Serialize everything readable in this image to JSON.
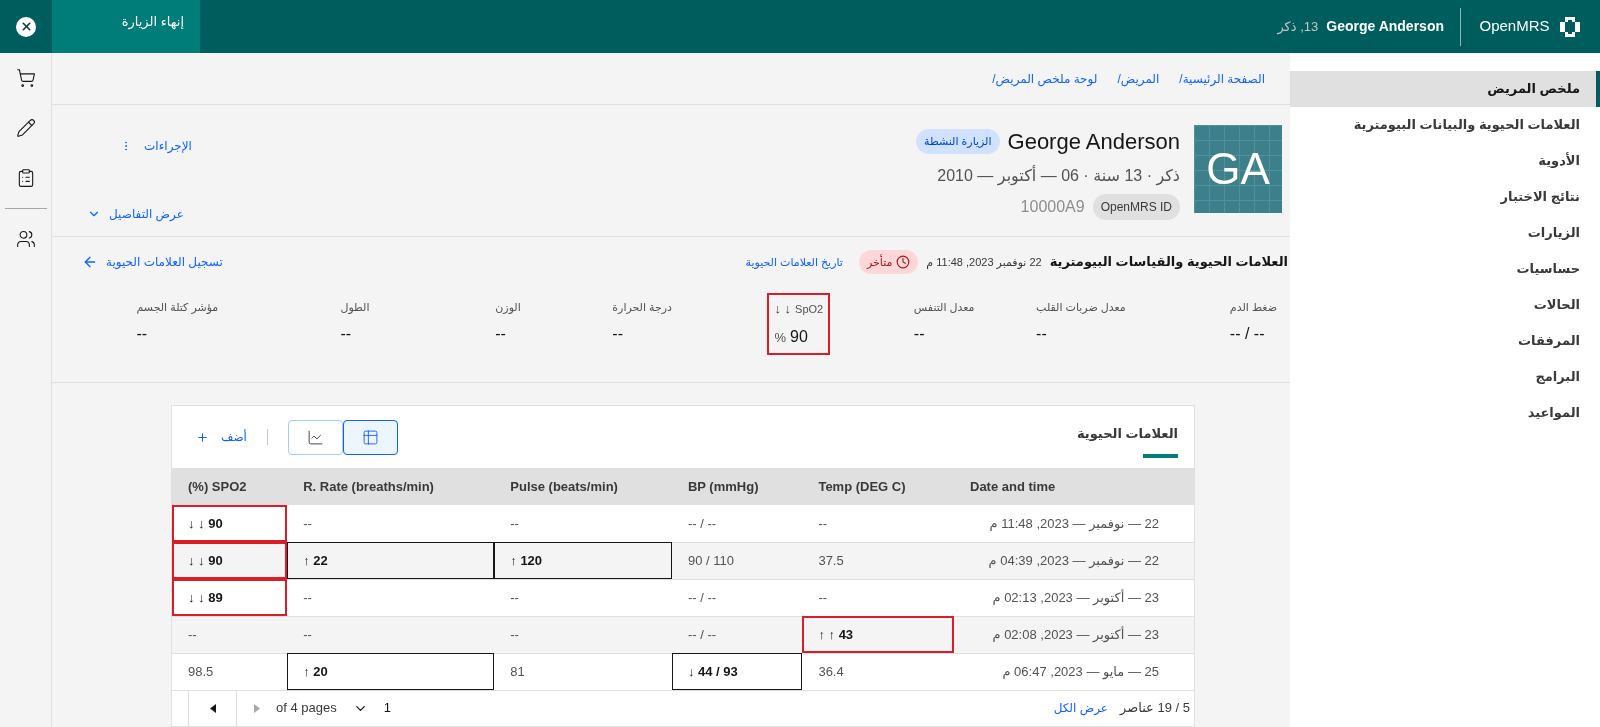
{
  "top_bar": {
    "end_visit_button": "إنهاء الزيارة",
    "patient_name": "George Anderson",
    "patient_info": "13, ذكر",
    "brand": "OpenMRS"
  },
  "breadcrumbs": [
    "الصفحة الرئيسية/",
    "المريض/",
    "لوحة ملخص المريض/"
  ],
  "patient": {
    "initials": "GA",
    "name": "George Anderson",
    "visit_tag": "الزيارة النشطة",
    "details": "ذكر · 13 سنة · 06 — أكتوبر — 2010",
    "id_label": "OpenMRS ID",
    "id_value": "10000A9",
    "actions": "الإجراءات",
    "show_details": "عرض التفاصيل"
  },
  "vitals_header": {
    "title": "العلامات الحيوية والقياسات البيومترية",
    "date": "22 نوفمبر 2023, 11:48 م",
    "status_tag": "متأخر",
    "history_link": "تاريخ العلامات الحيوية",
    "record_link": "تسجيل العلامات الحيوية"
  },
  "vitals_tiles": [
    {
      "label": "ضغط الدم",
      "value": "-- / --",
      "kind": "normal"
    },
    {
      "label": "معدل ضربات القلب",
      "value": "--",
      "kind": "normal"
    },
    {
      "label": "معدل التنفس",
      "value": "--",
      "kind": "normal"
    },
    {
      "label": "SpO2",
      "arrows": "↓ ↓",
      "value": "90",
      "unit": "%",
      "kind": "critical"
    },
    {
      "label": "درجة الحرارة",
      "value": "--",
      "kind": "normal"
    },
    {
      "label": "الوزن",
      "value": "--",
      "kind": "normal"
    },
    {
      "label": "الطول",
      "value": "--",
      "kind": "normal"
    },
    {
      "label": "مؤشر كتلة الجسم",
      "value": "--",
      "kind": "normal"
    }
  ],
  "vitals_card": {
    "title": "العلامات الحيوية",
    "views": [
      {
        "kind": "table",
        "selected": true
      },
      {
        "kind": "chart",
        "selected": false
      }
    ],
    "add_button": "أضف",
    "columns": [
      "Date and time",
      "Temp (DEG C)",
      "BP (mmHg)",
      "Pulse (beats/min)",
      "R. Rate (breaths/min)",
      "(%) SPO2"
    ],
    "rows": [
      {
        "cells": [
          {
            "text": "22 — نوفمبر — 2023, 11:48 م",
            "kind": "normal"
          },
          {
            "text": "--",
            "kind": "normal"
          },
          {
            "text": "-- / --",
            "kind": "normal"
          },
          {
            "text": "--",
            "kind": "normal"
          },
          {
            "text": "--",
            "kind": "normal"
          },
          {
            "text": "↓ ↓ 90",
            "kind": "critical"
          }
        ]
      },
      {
        "cells": [
          {
            "text": "22 — نوفمبر — 2023, 04:39 م",
            "kind": "normal"
          },
          {
            "text": "37.5",
            "kind": "normal"
          },
          {
            "text": "90 / 110",
            "kind": "normal"
          },
          {
            "text": "↑ 120",
            "kind": "abnormal"
          },
          {
            "text": "↑ 22",
            "kind": "abnormal"
          },
          {
            "text": "↓ ↓ 90",
            "kind": "critical"
          }
        ]
      },
      {
        "cells": [
          {
            "text": "23 — أكتوبر — 2023, 02:13 م",
            "kind": "normal"
          },
          {
            "text": "--",
            "kind": "normal"
          },
          {
            "text": "-- / --",
            "kind": "normal"
          },
          {
            "text": "--",
            "kind": "normal"
          },
          {
            "text": "--",
            "kind": "normal"
          },
          {
            "text": "↓ ↓ 89",
            "kind": "critical"
          }
        ]
      },
      {
        "cells": [
          {
            "text": "23 — أكتوبر — 2023, 02:08 م",
            "kind": "normal"
          },
          {
            "text": "↑ ↑ 43",
            "kind": "critical"
          },
          {
            "text": "-- / --",
            "kind": "normal"
          },
          {
            "text": "--",
            "kind": "normal"
          },
          {
            "text": "--",
            "kind": "normal"
          },
          {
            "text": "--",
            "kind": "normal"
          }
        ]
      },
      {
        "cells": [
          {
            "text": "25 — مايو — 2023, 06:47 م",
            "kind": "normal"
          },
          {
            "text": "36.4",
            "kind": "normal"
          },
          {
            "text": "↓ 44 / 93",
            "kind": "abnormal"
          },
          {
            "text": "81",
            "kind": "normal"
          },
          {
            "text": "↑ 20",
            "kind": "abnormal"
          },
          {
            "text": "98.5",
            "kind": "normal"
          }
        ]
      }
    ],
    "pagination": {
      "items_label": "5 / 19 عناصر",
      "see_all": "عرض الكل",
      "page": "1",
      "page_count": "of 4 pages"
    }
  },
  "sidebar": {
    "items": [
      {
        "label": "ملخص المريض",
        "selected": true
      },
      {
        "label": "العلامات الحيوية والبيانات البيومترية",
        "selected": false
      },
      {
        "label": "الأدوية",
        "selected": false
      },
      {
        "label": "نتائج الاختبار",
        "selected": false
      },
      {
        "label": "الزيارات",
        "selected": false
      },
      {
        "label": "حساسيات",
        "selected": false
      },
      {
        "label": "الحالات",
        "selected": false
      },
      {
        "label": "المرفقات",
        "selected": false
      },
      {
        "label": "البرامج",
        "selected": false
      },
      {
        "label": "المواعيد",
        "selected": false
      }
    ]
  }
}
